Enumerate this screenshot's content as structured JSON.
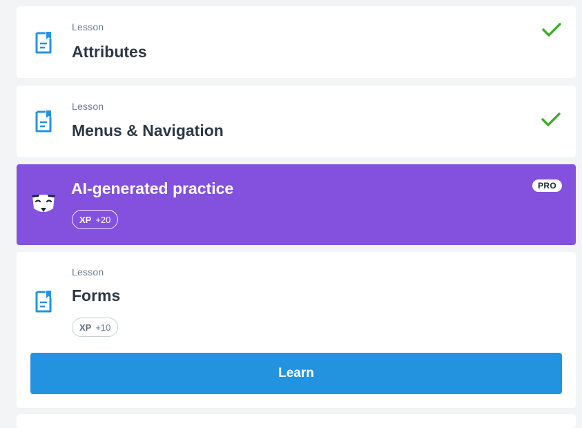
{
  "lessons": [
    {
      "type": "Lesson",
      "title": "Attributes",
      "completed": true
    },
    {
      "type": "Lesson",
      "title": "Menus & Navigation",
      "completed": true
    }
  ],
  "practice": {
    "title": "AI-generated practice",
    "badge": "PRO",
    "xp_label": "XP",
    "xp_value": "+20",
    "background_color": "#8351de"
  },
  "current_lesson": {
    "type": "Lesson",
    "title": "Forms",
    "xp_label": "XP",
    "xp_value": "+10",
    "button_label": "Learn"
  },
  "icons": {
    "lesson": "document-lesson-icon",
    "completed": "checkmark-icon",
    "mascot": "ai-mascot-icon"
  },
  "colors": {
    "page_background": "#f2f4f6",
    "accent_blue": "#2493df",
    "check_green": "#3fae29",
    "title_text": "#2d3846"
  }
}
